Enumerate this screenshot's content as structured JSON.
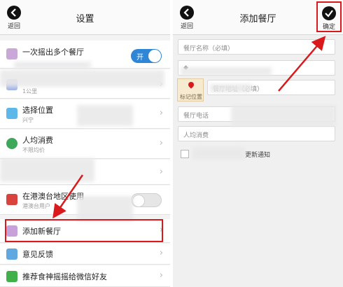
{
  "settings": {
    "title": "设置",
    "back_label": "返回",
    "multi": {
      "label": "一次摇出多个餐厅",
      "toggle_label": "开"
    },
    "distance": {
      "sub": "1公里"
    },
    "location": {
      "label": "选择位置",
      "sub": "兴宁"
    },
    "avg_spend": {
      "label": "人均消费",
      "sub": "不限均价"
    },
    "hk_macau": {
      "label": "在港澳台地区使用",
      "sub": "港澳台用户"
    },
    "add_restaurant": {
      "label": "添加新餐厅"
    },
    "feedback": {
      "label": "意见反馈"
    },
    "recommend": {
      "label": "推荐食神摇摇给微信好友"
    }
  },
  "add_form": {
    "title": "添加餐厅",
    "back_label": "返回",
    "confirm_label": "确定",
    "name_placeholder": "餐厅名称（必填）",
    "address_placeholder": "餐厅地址（必填）",
    "map_label": "标记位置",
    "phone_placeholder": "餐厅电话",
    "spend_placeholder": "人均消费",
    "notify_label": "更新通知"
  },
  "colors": {
    "accent_blue": "#2f86d6",
    "highlight_red": "#d9191c"
  },
  "icons": {
    "back": "back-arrow-icon",
    "confirm": "checkmark-icon"
  }
}
